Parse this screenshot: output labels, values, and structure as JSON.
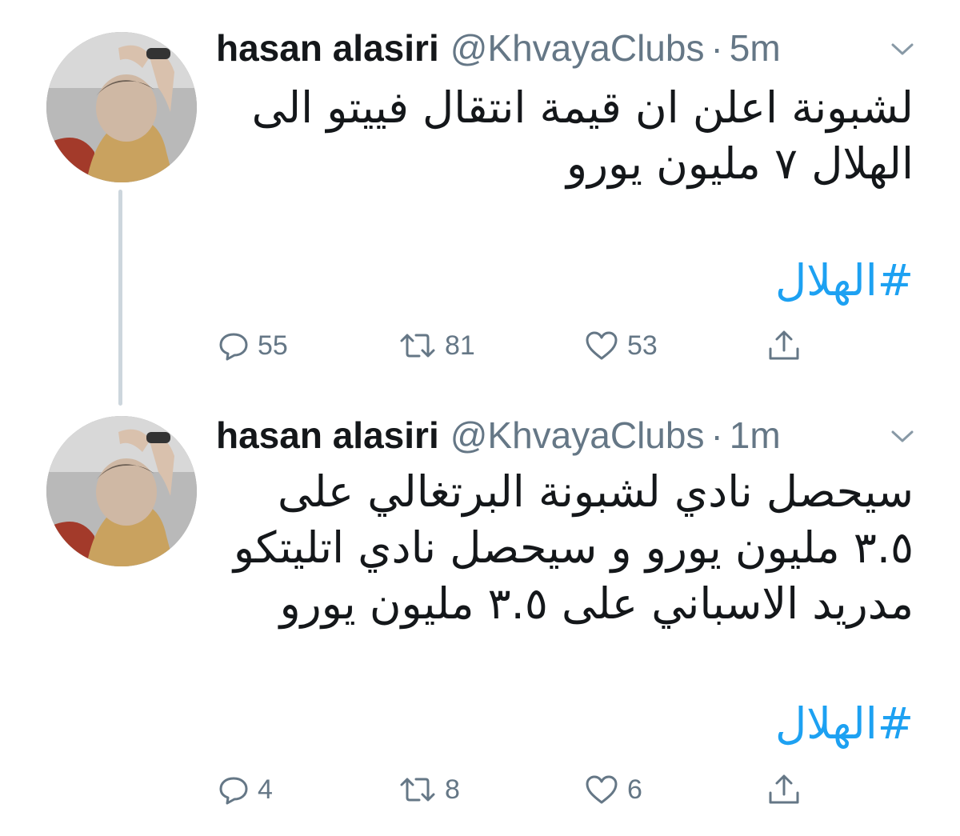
{
  "tweets": [
    {
      "name": "hasan alasiri",
      "handle": "@KhvayaClubs",
      "separator": "·",
      "time": "5m",
      "text": "لشبونة اعلن ان قيمة انتقال فييتو الى الهلال ٧ مليون يورو",
      "hashtag": "#الهلال",
      "replies": "55",
      "retweets": "81",
      "likes": "53"
    },
    {
      "name": "hasan alasiri",
      "handle": "@KhvayaClubs",
      "separator": "·",
      "time": "1m",
      "text": "سيحصل نادي لشبونة البرتغالي على ٣.٥ مليون يورو و سيحصل نادي اتليتكو مدريد الاسباني على ٣.٥ مليون يورو",
      "hashtag": "#الهلال",
      "replies": "4",
      "retweets": "8",
      "likes": "6"
    }
  ],
  "colors": {
    "text": "#14171a",
    "secondary": "#657786",
    "link": "#1da1f2",
    "thread_line": "#cdd6dd"
  },
  "icons": {
    "reply": "reply-icon",
    "retweet": "retweet-icon",
    "like": "heart-icon",
    "share": "share-icon",
    "menu": "chevron-down-icon"
  }
}
